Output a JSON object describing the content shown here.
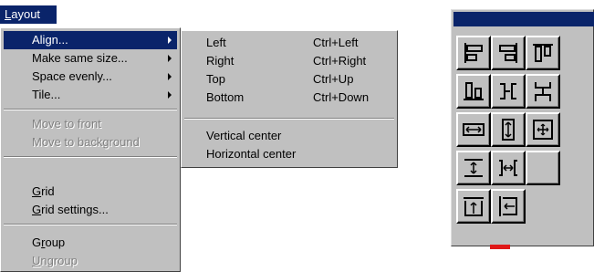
{
  "menu_bar": {
    "title": "Layout",
    "title_accel": "L",
    "title_rest": "ayout"
  },
  "main_menu": {
    "items": [
      {
        "label": "Align...",
        "state": "selected",
        "submenu": true
      },
      {
        "label": "Make same size...",
        "state": "normal",
        "submenu": true
      },
      {
        "label": "Space evenly...",
        "state": "normal",
        "submenu": true
      },
      {
        "label": "Tile...",
        "state": "normal",
        "submenu": true
      },
      {
        "label": "Move to front",
        "state": "disabled",
        "submenu": false
      },
      {
        "label": "Move to background",
        "state": "disabled",
        "submenu": false
      },
      {
        "label": "Grid",
        "accel": "G",
        "rest": "rid",
        "state": "normal",
        "submenu": false
      },
      {
        "label": "Grid settings...",
        "accel": "G",
        "rest": "rid settings...",
        "state": "normal",
        "submenu": false
      },
      {
        "label": "Group",
        "pre": "G",
        "accel": "r",
        "rest": "oup",
        "state": "normal",
        "submenu": false
      },
      {
        "label": "Ungroup",
        "accel": "U",
        "rest": "ngroup",
        "state": "disabled",
        "submenu": false
      }
    ]
  },
  "align_submenu": {
    "items": [
      {
        "label": "Left",
        "shortcut": "Ctrl+Left"
      },
      {
        "label": "Right",
        "shortcut": "Ctrl+Right"
      },
      {
        "label": "Top",
        "shortcut": "Ctrl+Up"
      },
      {
        "label": "Bottom",
        "shortcut": "Ctrl+Down"
      },
      {
        "label": "Vertical center",
        "shortcut": ""
      },
      {
        "label": "Horizontal center",
        "shortcut": ""
      }
    ]
  },
  "palette": {
    "buttons": [
      "align-left-icon",
      "align-right-icon",
      "align-top-icon",
      "align-bottom-icon",
      "vertical-center-icon",
      "horizontal-center-icon",
      "same-width-icon",
      "same-height-icon",
      "same-size-icon",
      "space-vertical-icon",
      "space-horizontal-icon",
      "blank-icon",
      "tile-vertical-icon",
      "tile-horizontal-icon"
    ]
  },
  "colors": {
    "highlight": "#0a246a",
    "menu_bg": "#c0c0c0",
    "disabled_text": "#808080"
  }
}
